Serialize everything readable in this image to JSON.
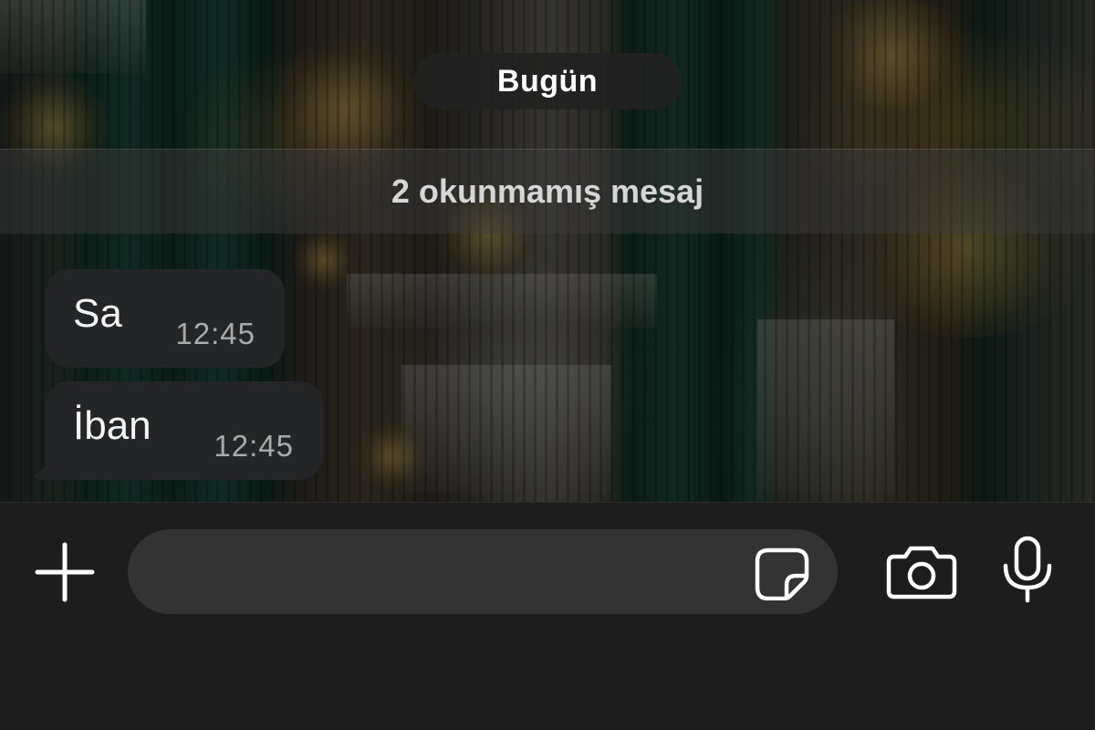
{
  "chat": {
    "date_label": "Bugün",
    "unread_banner": "2 okunmamış mesaj",
    "messages": [
      {
        "text": "Sa",
        "time": "12:45",
        "direction": "incoming"
      },
      {
        "text": "İban",
        "time": "12:45",
        "direction": "incoming"
      }
    ]
  },
  "composer": {
    "input_value": "",
    "icons": {
      "add": "plus-icon",
      "sticker": "sticker-icon",
      "camera": "camera-icon",
      "microphone": "microphone-icon"
    }
  },
  "colors": {
    "bubble_incoming": "#242526",
    "input_bar": "#1d1d1e",
    "input_field": "#333334",
    "timestamp": "#a9a9a9"
  }
}
